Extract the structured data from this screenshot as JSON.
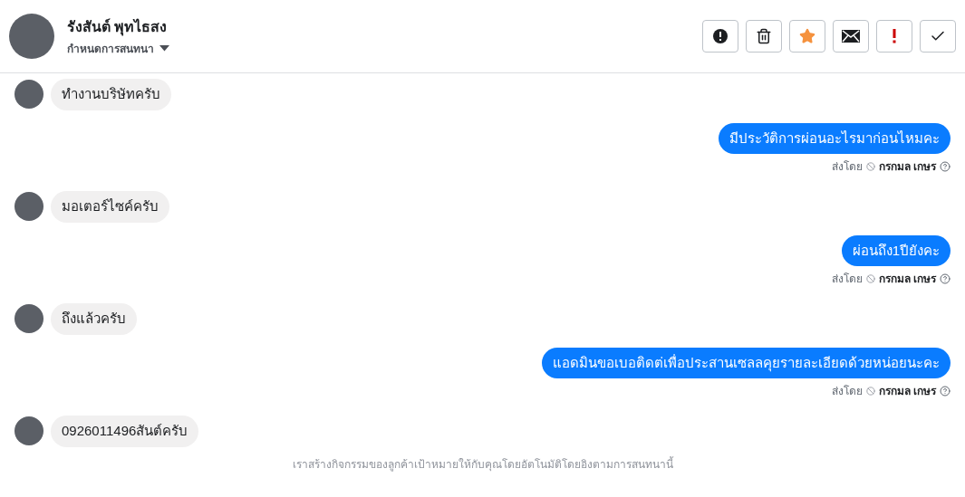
{
  "header": {
    "name": "รังสันต์ พุทไธสง",
    "subtitle": "กำหนดการสนทนา"
  },
  "actions": [
    {
      "kind": "alert"
    },
    {
      "kind": "trash"
    },
    {
      "kind": "star"
    },
    {
      "kind": "mail"
    },
    {
      "kind": "urgent"
    },
    {
      "kind": "check"
    }
  ],
  "messages": [
    {
      "kind": "incoming",
      "text": "ทำงานบริษัทครับ"
    },
    {
      "kind": "outgoing",
      "text": "มีประวัติการผ่อนอะไรมาก่อนไหมคะ",
      "sent_by": "ส่งโดย",
      "sender": "กรกมล เกษร"
    },
    {
      "kind": "incoming",
      "text": "มอเตอร์ไซค์ครับ"
    },
    {
      "kind": "outgoing",
      "text": "ผ่อนถึง1ปียังคะ",
      "sent_by": "ส่งโดย",
      "sender": "กรกมล เกษร"
    },
    {
      "kind": "incoming",
      "text": "ถึงแล้วครับ"
    },
    {
      "kind": "outgoing",
      "text": "แอดมินขอเบอติดต่เพื่อประสานเซลลคุยรายละเอียดด้วยหน่อยนะคะ",
      "sent_by": "ส่งโดย",
      "sender": "กรกมล เกษร"
    },
    {
      "kind": "incoming",
      "text": "0926011496สันต์ครับ"
    }
  ],
  "footer": "เราสร้างกิจกรรมของลูกค้าเป้าหมายให้กับคุณโดยอัตโนมัติโดยอิงตามการสนทนานี้"
}
